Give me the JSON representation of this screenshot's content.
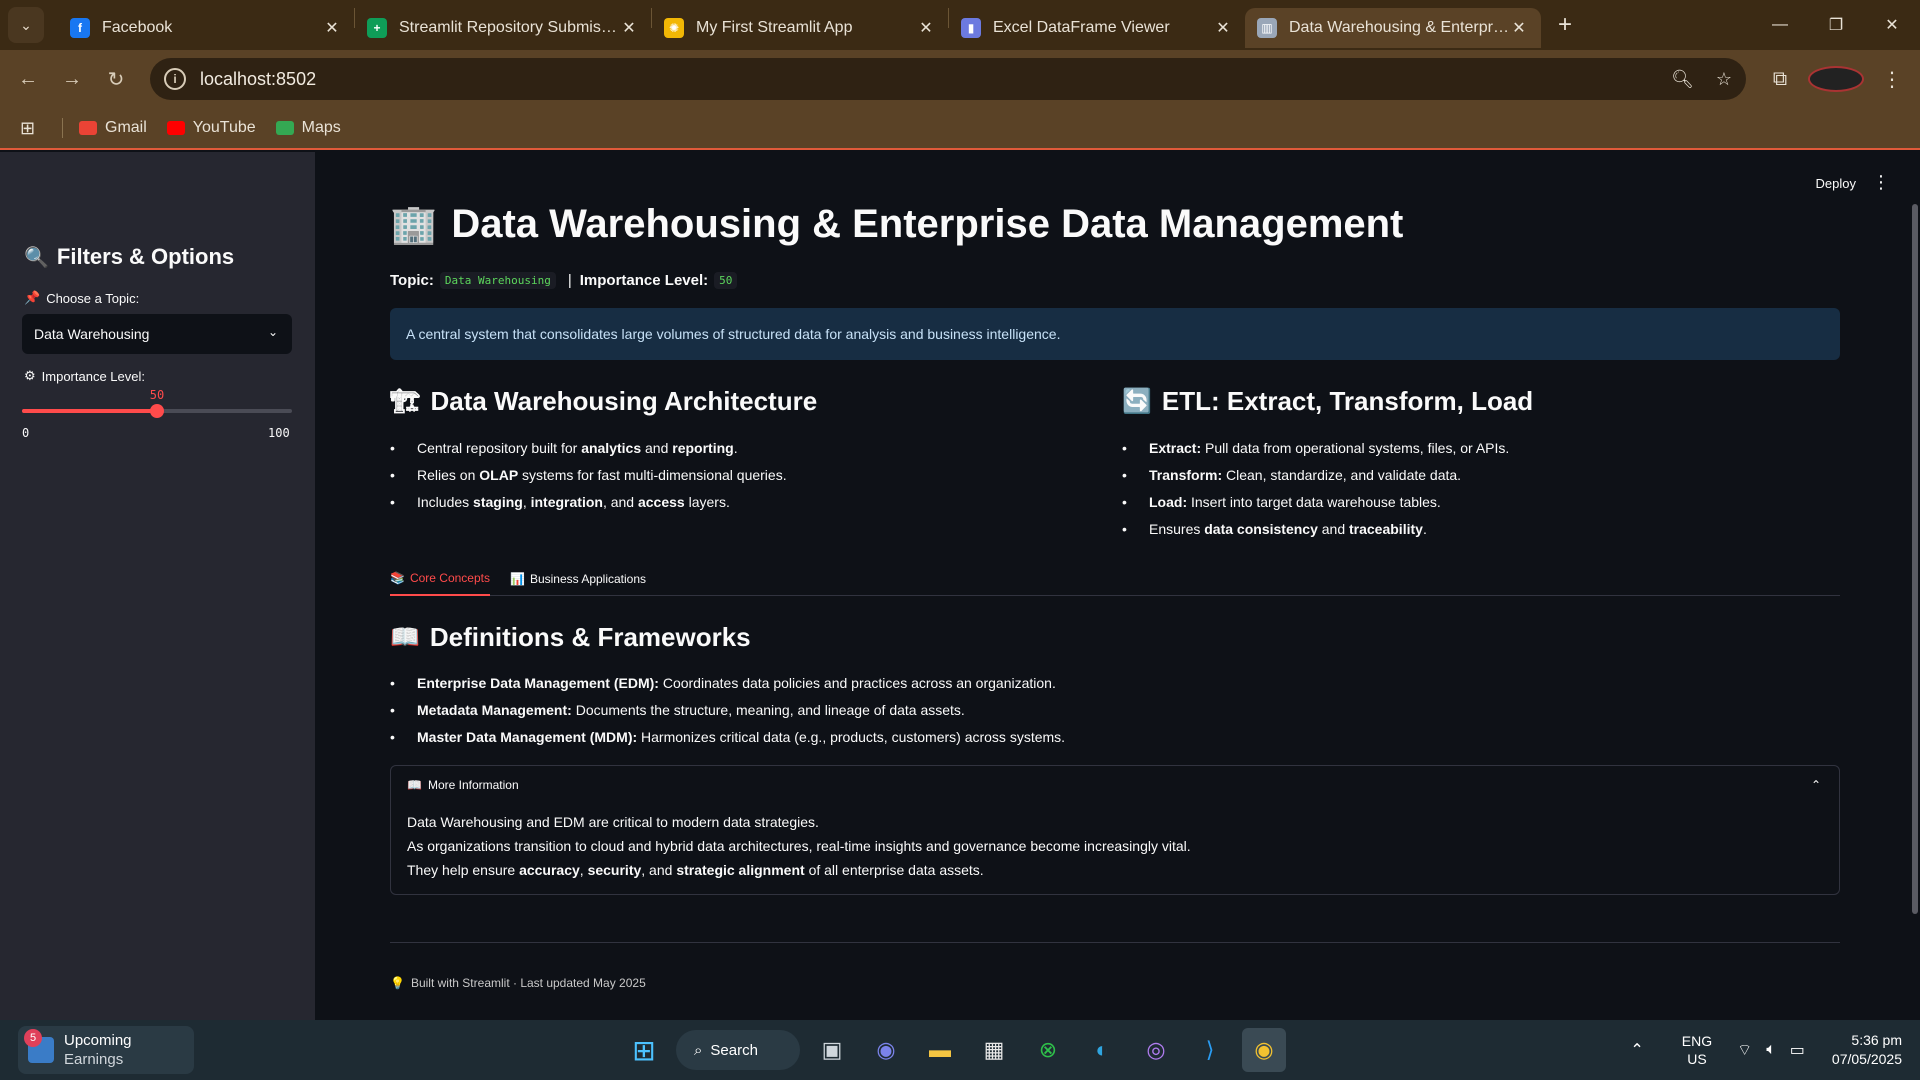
{
  "browser": {
    "tabs": [
      {
        "title": "Facebook",
        "favicon": "facebook-icon",
        "color": "#1877f2",
        "glyph": "f",
        "active": false
      },
      {
        "title": "Streamlit Repository Submission",
        "favicon": "sheets-icon",
        "color": "#0f9d58",
        "glyph": "+",
        "active": false
      },
      {
        "title": "My First Streamlit App",
        "favicon": "sun-icon",
        "color": "#f2b705",
        "glyph": "✺",
        "active": false
      },
      {
        "title": "Excel DataFrame Viewer",
        "favicon": "chart-icon",
        "color": "#6c7ae0",
        "glyph": "▮",
        "active": false
      },
      {
        "title": "Data Warehousing & Enterprise Data Management",
        "favicon": "building-icon",
        "color": "#9aa7b8",
        "glyph": "▥",
        "active": true
      }
    ],
    "url": "localhost:8502",
    "bookmarks": [
      {
        "label": "Gmail",
        "color": "#ea4335"
      },
      {
        "label": "YouTube",
        "color": "#ff0000"
      },
      {
        "label": "Maps",
        "color": "#34a853"
      }
    ]
  },
  "sidebar": {
    "title": "Filters & Options",
    "title_icon": "🔍",
    "topic_label": "Choose a Topic:",
    "topic_icon": "📌",
    "topic_value": "Data Warehousing",
    "importance_label": "Importance Level:",
    "importance_icon": "⚙",
    "slider": {
      "value": "50",
      "min": "0",
      "max": "100",
      "fraction": 0.5
    }
  },
  "header": {
    "deploy": "Deploy"
  },
  "main": {
    "title": "Data Warehousing & Enterprise Data Management",
    "title_icon": "🏢",
    "topic_label": "Topic:",
    "topic_value": "Data Warehousing",
    "separator": "|",
    "importance_label": "Importance Level:",
    "importance_value": "50",
    "info": "A central system that consolidates large volumes of structured data for analysis and business intelligence.",
    "arch": {
      "icon": "🏗",
      "title": "Data Warehousing Architecture",
      "items": [
        "Central repository built for analytics and reporting.",
        "Relies on OLAP systems for fast multi-dimensional queries.",
        "Includes staging, integration, and access layers."
      ]
    },
    "etl": {
      "icon": "🔄",
      "title": "ETL: Extract, Transform, Load",
      "items": [
        "Extract: Pull data from operational systems, files, or APIs.",
        "Transform: Clean, standardize, and validate data.",
        "Load: Insert into target data warehouse tables.",
        "Ensures data consistency and traceability."
      ]
    },
    "tabs": [
      {
        "icon": "📚",
        "label": "Core Concepts",
        "active": true
      },
      {
        "icon": "📊",
        "label": "Business Applications",
        "active": false
      }
    ],
    "definitions": {
      "icon": "📖",
      "title": "Definitions & Frameworks",
      "items": [
        "Enterprise Data Management (EDM): Coordinates data policies and practices across an organization.",
        "Metadata Management: Documents the structure, meaning, and lineage of data assets.",
        "Master Data Management (MDM): Harmonizes critical data (e.g., products, customers) across systems."
      ]
    },
    "expander": {
      "icon": "📖",
      "title": "More Information",
      "lines": [
        "Data Warehousing and EDM are critical to modern data strategies.",
        "As organizations transition to cloud and hybrid data architectures, real-time insights and governance become increasingly vital.",
        "They help ensure accuracy, security, and strategic alignment of all enterprise data assets."
      ]
    },
    "footer": {
      "icon": "💡",
      "text": "Built with Streamlit · Last updated May 2025"
    }
  },
  "taskbar": {
    "weather_badge": "5",
    "weather_title": "Upcoming",
    "weather_sub": "Earnings",
    "search": "Search",
    "lang_top": "ENG",
    "lang_bottom": "US",
    "time": "5:36 pm",
    "date": "07/05/2025"
  }
}
